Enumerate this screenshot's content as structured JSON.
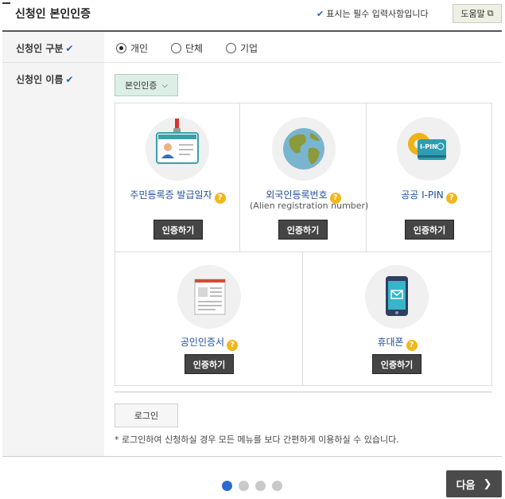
{
  "header": {
    "title": "신청인 본인인증",
    "required_note": "표시는 필수 입력사항입니다",
    "help_label": "도움말"
  },
  "applicant_type": {
    "label": "신청인 구분",
    "options": [
      {
        "label": "개인",
        "selected": true
      },
      {
        "label": "단체",
        "selected": false
      },
      {
        "label": "기업",
        "selected": false
      }
    ]
  },
  "applicant_name": {
    "label": "신청인 이름",
    "dropdown_value": "본인인증"
  },
  "methods": [
    {
      "label": "주민등록증 발급일자",
      "sub": "",
      "button": "인증하기",
      "icon": "id-card-icon"
    },
    {
      "label": "외국인등록번호",
      "sub": "(Alien registration number)",
      "button": "인증하기",
      "icon": "globe-icon"
    },
    {
      "label": "공공 I-PIN",
      "sub": "",
      "button": "인증하기",
      "icon": "ipin-card-icon",
      "icon_text": "I-PIN"
    },
    {
      "label": "공인인증서",
      "sub": "",
      "button": "인증하기",
      "icon": "certificate-icon"
    },
    {
      "label": "휴대폰",
      "sub": "",
      "button": "인증하기",
      "icon": "mobile-phone-icon"
    }
  ],
  "help_mark": "?",
  "login": {
    "button": "로그인",
    "note": "* 로그인하여 신청하실 경우 모든 메뉴를 보다 간편하게 이용하실 수 있습니다."
  },
  "pagination": {
    "current": 1,
    "total": 4
  },
  "next_label": "다음",
  "colors": {
    "accent": "#2b6bd1",
    "link": "#1f4e9a",
    "button": "#454545",
    "dropdown": "#ddeee7"
  }
}
